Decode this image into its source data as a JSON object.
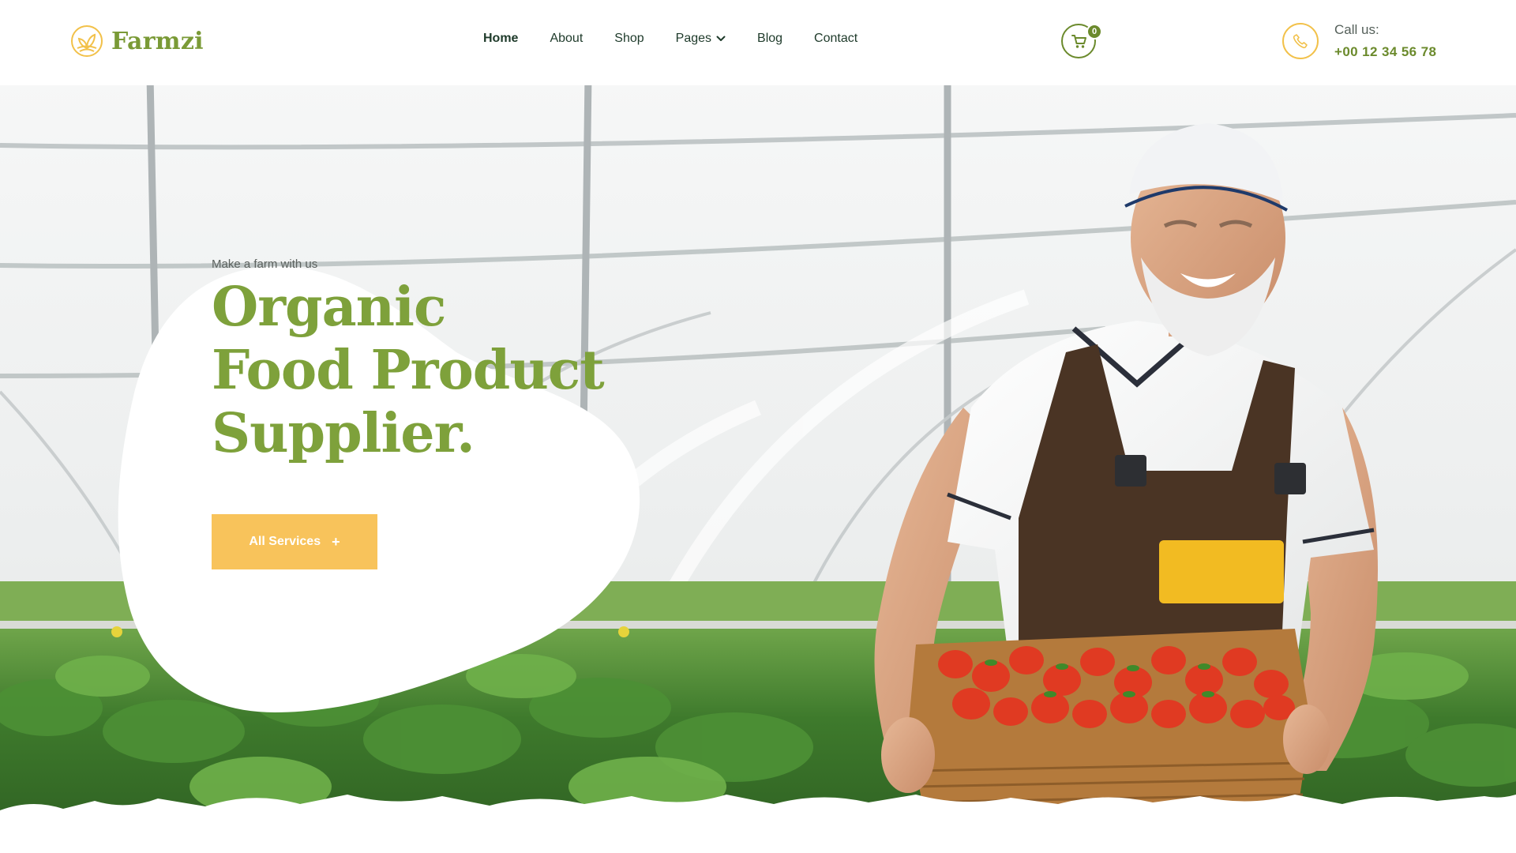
{
  "brand": {
    "name": "Farmzi"
  },
  "nav": {
    "items": [
      {
        "label": "Home",
        "active": true
      },
      {
        "label": "About"
      },
      {
        "label": "Shop"
      },
      {
        "label": "Pages",
        "has_dropdown": true
      },
      {
        "label": "Blog"
      },
      {
        "label": "Contact"
      }
    ]
  },
  "cart": {
    "count": "0",
    "icon": "cart-icon"
  },
  "call": {
    "label": "Call us:",
    "number": "+00 12 34 56 78",
    "icon": "phone-icon"
  },
  "hero": {
    "kicker": "Make a farm with us",
    "headline": [
      "Organic",
      "Food Product",
      "Supplier."
    ],
    "cta_label": "All Services",
    "cta_icon": "+"
  },
  "colors": {
    "brand_green": "#7ea13b",
    "dark_green": "#6b8a2c",
    "accent_yellow": "#f8c35b",
    "text_dark": "#1e3a2a"
  }
}
